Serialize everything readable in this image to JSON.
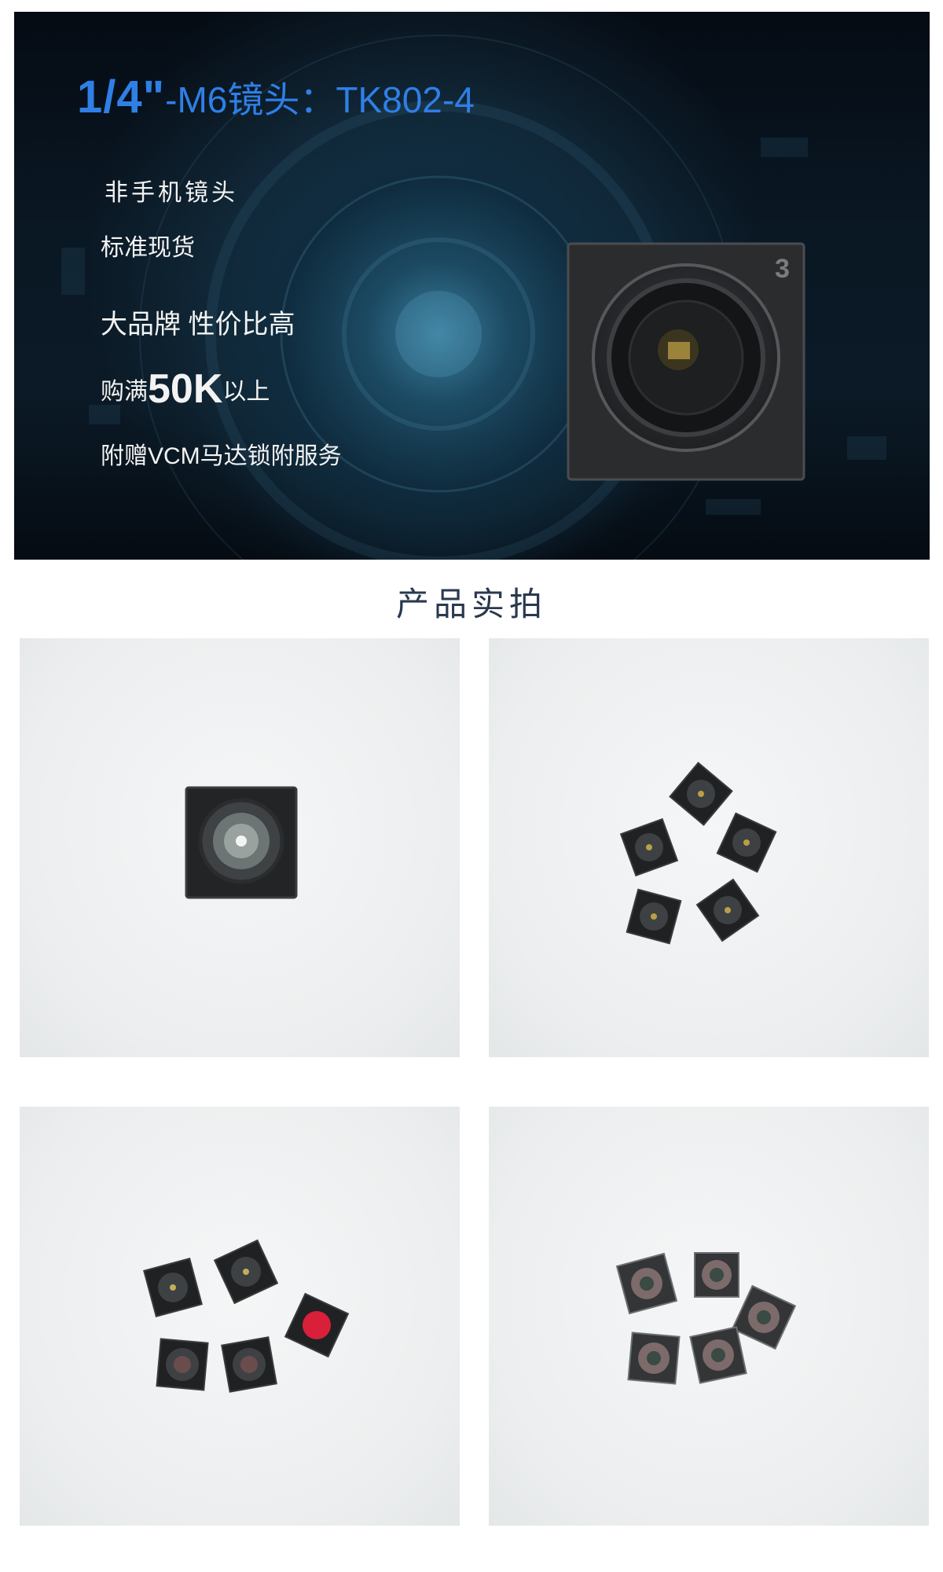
{
  "banner": {
    "title_size": "1/4\"",
    "title_name": "-M6镜头：TK802-4",
    "features": {
      "f1": "非手机镜头",
      "f2": "标准现货",
      "f3": "大品牌 性价比高",
      "f4_prefix": "购满",
      "f4_big": "50K",
      "f4_suffix": "以上",
      "f5": "附赠VCM马达锁附服务"
    },
    "lens_marking": "3"
  },
  "section": {
    "title": "产品实拍"
  },
  "colors": {
    "title_blue": "#2f7fe6",
    "section_title": "#2a3950",
    "photo_background": "#eef0f1"
  }
}
